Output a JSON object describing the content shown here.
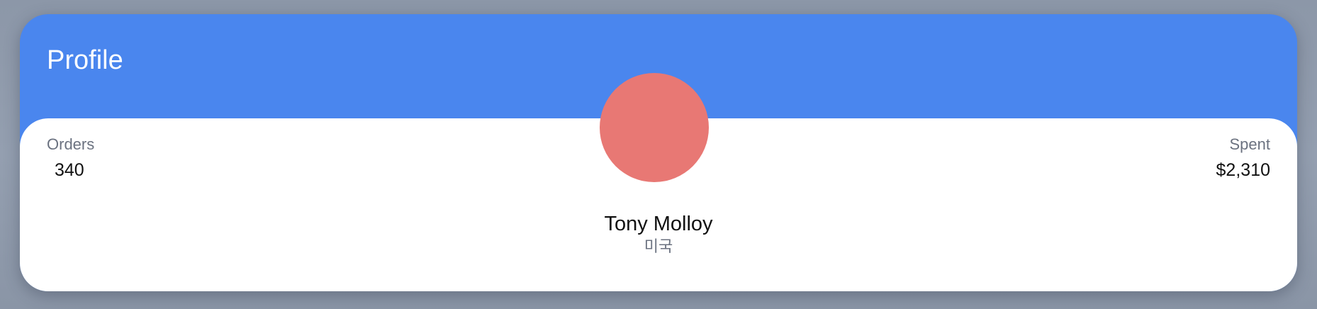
{
  "header": {
    "title": "Profile"
  },
  "stats": {
    "orders": {
      "label": "Orders",
      "value": "340"
    },
    "spent": {
      "label": "Spent",
      "value": "$2,310"
    }
  },
  "user": {
    "name": "Tony Molloy",
    "country": "미국"
  },
  "colors": {
    "header_bg": "#4a86ee",
    "avatar_bg": "#e87874",
    "card_bg": "#ffffff",
    "muted_text": "#6b7280"
  }
}
